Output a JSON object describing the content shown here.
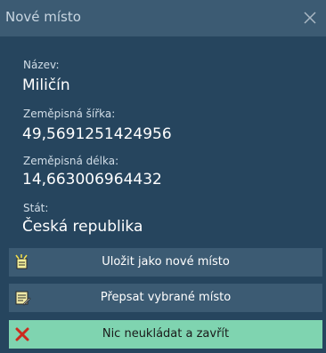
{
  "window": {
    "title": "Nové místo"
  },
  "fields": [
    {
      "label": "Název:",
      "value": "Miličín"
    },
    {
      "label": "Zeměpisná šířka:",
      "value": "49,5691251424956"
    },
    {
      "label": "Zeměpisná délka:",
      "value": "14,663006964432"
    },
    {
      "label": "Stát:",
      "value": "Česká republika"
    }
  ],
  "buttons": {
    "save_new": {
      "label": "Uložit jako nové místo",
      "icon": "save-new-icon"
    },
    "overwrite": {
      "label": "Přepsat vybrané místo",
      "icon": "overwrite-icon"
    },
    "discard": {
      "label": "Nic neukládat a zavřít",
      "icon": "close-x-icon"
    }
  },
  "colors": {
    "window_bg": "#26455e",
    "titlebar_bg": "#3c5b73",
    "button_bg": "#3c5b73",
    "discard_button_bg": "#7fd4b0",
    "discard_icon": "#cc2a1e"
  }
}
